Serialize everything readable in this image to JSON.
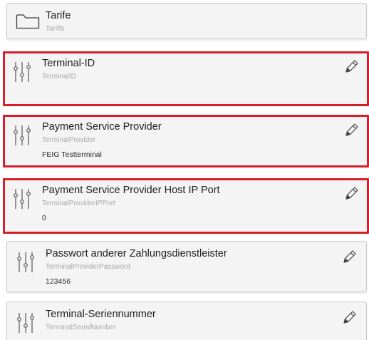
{
  "settings": [
    {
      "title": "Tarife",
      "key": "Tariffs",
      "value": "",
      "icon": "folder-icon",
      "highlighted": false
    },
    {
      "title": "Terminal-ID",
      "key": "TerminalID",
      "value": "",
      "icon": "sliders-icon",
      "highlighted": true
    },
    {
      "title": "Payment Service Provider",
      "key": "TerminalProvider",
      "value": "FEIG Testterminal",
      "icon": "sliders-icon",
      "highlighted": true
    },
    {
      "title": "Payment Service Provider Host IP Port",
      "key": "TerminalProviderIPPort",
      "value": "0",
      "icon": "sliders-icon",
      "highlighted": true
    },
    {
      "title": "Passwort anderer Zahlungsdienstleister",
      "key": "TerminalProviderPassword",
      "value": "123456",
      "icon": "sliders-icon",
      "highlighted": false
    },
    {
      "title": "Terminal-Seriennummer",
      "key": "TerminalSerialNumber",
      "value": "",
      "icon": "sliders-icon",
      "highlighted": false
    }
  ],
  "colors": {
    "highlight_border": "#d4202b",
    "card_background": "#f4f4f4",
    "card_border": "#c9c9c9"
  },
  "edit_icon": "pencil-icon"
}
